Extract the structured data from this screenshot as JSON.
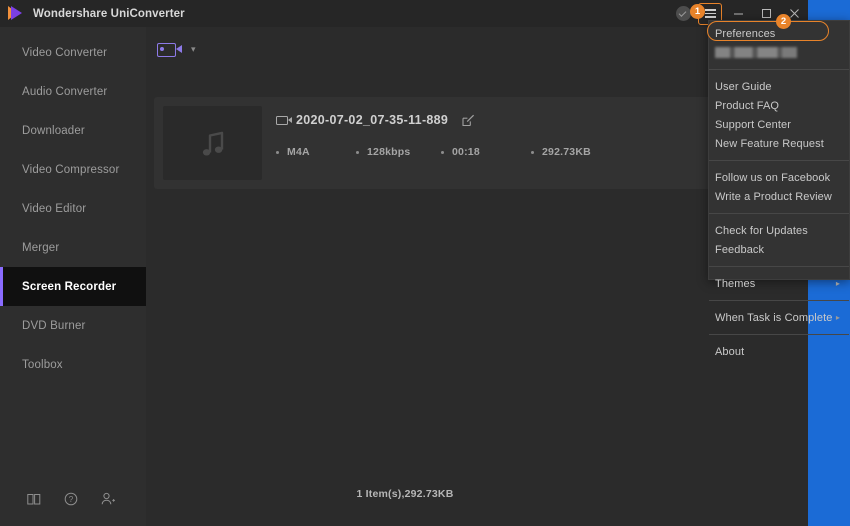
{
  "window": {
    "title": "Wondershare UniConverter",
    "logo_icon": "wondershare-play-logo",
    "controls": {
      "avatar_icon": "user-avatar-icon",
      "menu_icon": "hamburger-menu-icon",
      "minimize_icon": "minimize-icon",
      "maximize_icon": "maximize-icon",
      "close_icon": "close-icon"
    }
  },
  "sidebar": {
    "items": [
      {
        "label": "Video Converter",
        "active": false
      },
      {
        "label": "Audio Converter",
        "active": false
      },
      {
        "label": "Downloader",
        "active": false
      },
      {
        "label": "Video Compressor",
        "active": false
      },
      {
        "label": "Video Editor",
        "active": false
      },
      {
        "label": "Merger",
        "active": false
      },
      {
        "label": "Screen Recorder",
        "active": true
      },
      {
        "label": "DVD Burner",
        "active": false
      },
      {
        "label": "Toolbox",
        "active": false
      }
    ],
    "bottom_icons": [
      {
        "name": "user-guide-book-icon"
      },
      {
        "name": "help-question-icon"
      },
      {
        "name": "add-user-icon"
      }
    ]
  },
  "toolbar": {
    "recorder_mode_icon": "video-camera-icon",
    "dropdown_chevron": "chevron-down-icon"
  },
  "file_card": {
    "thumbnail_icon": "music-note-icon",
    "type_icon": "video-file-icon",
    "filename": "2020-07-02_07-35-11-889",
    "edit_icon": "edit-pencil-icon",
    "meta": [
      "M4A",
      "128kbps",
      "00:18",
      "292.73KB"
    ]
  },
  "status": {
    "summary": "1 Item(s),292.73KB"
  },
  "menu": {
    "groups": [
      {
        "items": [
          {
            "label": "Preferences",
            "highlighted": true,
            "submenu": false
          },
          {
            "label": "",
            "blurred": true,
            "submenu": false
          }
        ]
      },
      {
        "items": [
          {
            "label": "User Guide",
            "submenu": false
          },
          {
            "label": "Product FAQ",
            "submenu": false
          },
          {
            "label": "Support Center",
            "submenu": false
          },
          {
            "label": "New Feature Request",
            "submenu": false
          }
        ]
      },
      {
        "items": [
          {
            "label": "Follow us on Facebook",
            "submenu": false
          },
          {
            "label": "Write a Product Review",
            "submenu": false
          }
        ]
      },
      {
        "items": [
          {
            "label": "Check for Updates",
            "submenu": false
          },
          {
            "label": "Feedback",
            "submenu": false
          }
        ]
      },
      {
        "items": [
          {
            "label": "Themes",
            "submenu": true,
            "arrow": "▸"
          }
        ]
      },
      {
        "items": [
          {
            "label": "When Task is Complete",
            "submenu": true,
            "arrow": "▸"
          }
        ]
      },
      {
        "items": [
          {
            "label": "About",
            "submenu": false
          }
        ]
      }
    ]
  },
  "annotations": {
    "badges": [
      {
        "number": "1",
        "target": "hamburger-menu-icon"
      },
      {
        "number": "2",
        "target": "preferences-menu-item"
      }
    ],
    "highlight_color": "#e8832a"
  },
  "colors": {
    "desktop": "#1b6bd6",
    "window_bg": "#2b2b2b",
    "titlebar": "#262626",
    "sidebar": "#2e2e2e",
    "active_accent": "#8a6bff",
    "card": "#323232",
    "menu_bg": "#333333",
    "annotation": "#e8832a"
  }
}
